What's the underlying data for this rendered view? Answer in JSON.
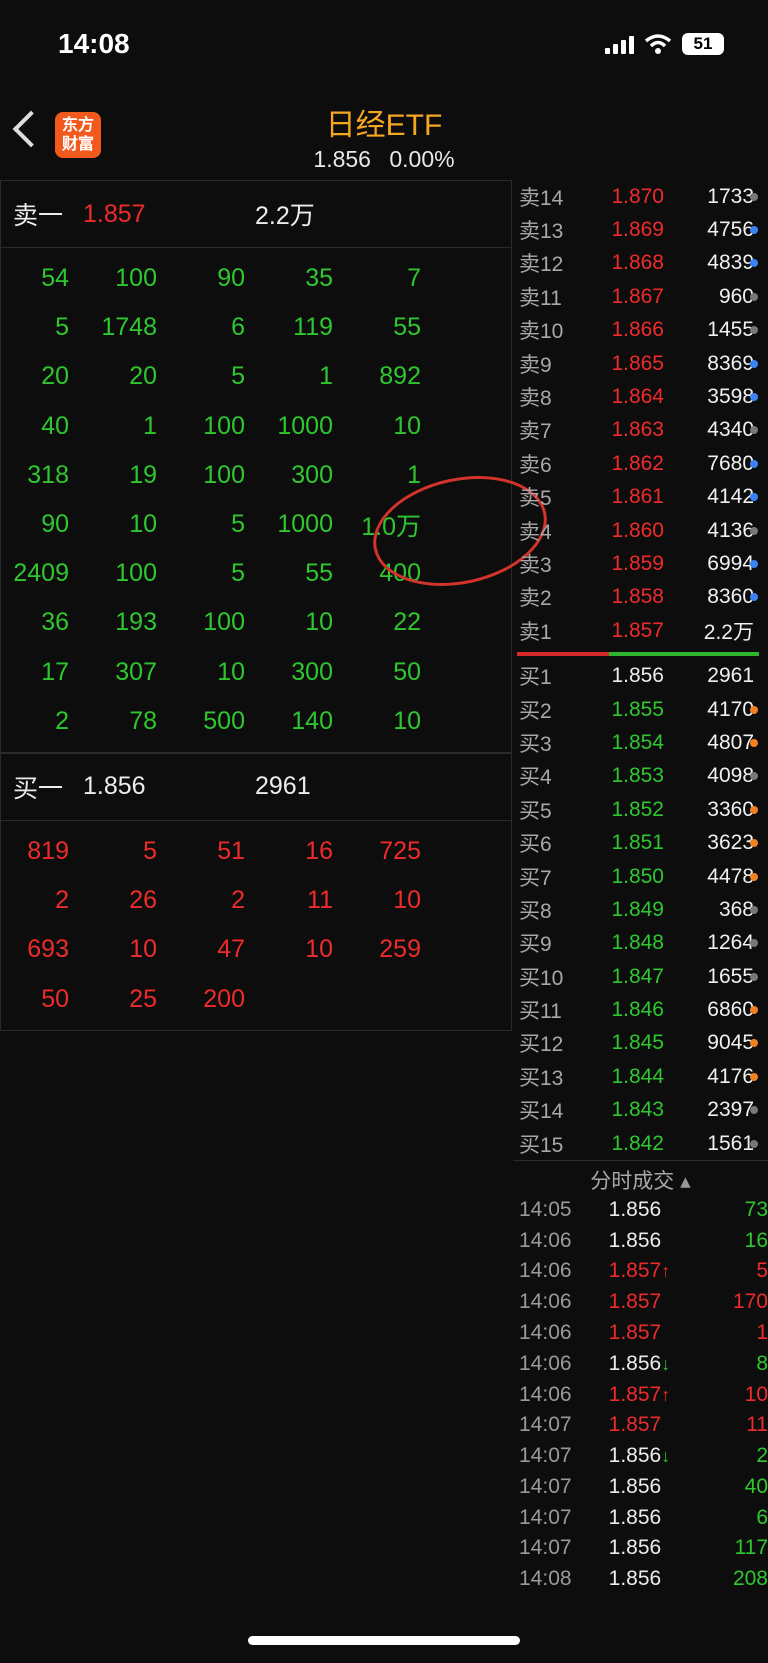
{
  "status": {
    "time": "14:08",
    "battery": "51"
  },
  "header": {
    "logo_line1": "东方",
    "logo_line2": "财富",
    "title": "日经ETF",
    "price": "1.856",
    "change": "0.00%"
  },
  "left": {
    "sell1": {
      "label": "卖一",
      "price": "1.857",
      "volume": "2.2万"
    },
    "sell_queue": [
      [
        "54",
        "100",
        "90",
        "35",
        "7"
      ],
      [
        "5",
        "1748",
        "6",
        "119",
        "55"
      ],
      [
        "20",
        "20",
        "5",
        "1",
        "892"
      ],
      [
        "40",
        "1",
        "100",
        "1000",
        "10"
      ],
      [
        "318",
        "19",
        "100",
        "300",
        "1"
      ],
      [
        "90",
        "10",
        "5",
        "1000",
        "1.0万"
      ],
      [
        "2409",
        "100",
        "5",
        "55",
        "400"
      ],
      [
        "36",
        "193",
        "100",
        "10",
        "22"
      ],
      [
        "17",
        "307",
        "10",
        "300",
        "50"
      ],
      [
        "2",
        "78",
        "500",
        "140",
        "10"
      ]
    ],
    "buy1": {
      "label": "买一",
      "price": "1.856",
      "volume": "2961"
    },
    "buy_queue": [
      [
        "819",
        "5",
        "51",
        "16",
        "725"
      ],
      [
        "2",
        "26",
        "2",
        "11",
        "10"
      ],
      [
        "693",
        "10",
        "47",
        "10",
        "259"
      ],
      [
        "50",
        "25",
        "200",
        "",
        ""
      ]
    ]
  },
  "asks": [
    {
      "label": "卖14",
      "price": "1.870",
      "volume": "1733",
      "dot": "#777777"
    },
    {
      "label": "卖13",
      "price": "1.869",
      "volume": "4756",
      "dot": "#3b82f6"
    },
    {
      "label": "卖12",
      "price": "1.868",
      "volume": "4839",
      "dot": "#3b82f6"
    },
    {
      "label": "卖11",
      "price": "1.867",
      "volume": "960",
      "dot": "#777777"
    },
    {
      "label": "卖10",
      "price": "1.866",
      "volume": "1455",
      "dot": "#777777"
    },
    {
      "label": "卖9",
      "price": "1.865",
      "volume": "8369",
      "dot": "#3b82f6"
    },
    {
      "label": "卖8",
      "price": "1.864",
      "volume": "3598",
      "dot": "#3b82f6"
    },
    {
      "label": "卖7",
      "price": "1.863",
      "volume": "4340",
      "dot": "#777777"
    },
    {
      "label": "卖6",
      "price": "1.862",
      "volume": "7680",
      "dot": "#3b82f6"
    },
    {
      "label": "卖5",
      "price": "1.861",
      "volume": "4142",
      "dot": "#3b82f6"
    },
    {
      "label": "卖4",
      "price": "1.860",
      "volume": "4136",
      "dot": "#777777"
    },
    {
      "label": "卖3",
      "price": "1.859",
      "volume": "6994",
      "dot": "#3b82f6"
    },
    {
      "label": "卖2",
      "price": "1.858",
      "volume": "8360",
      "dot": "#3b82f6"
    },
    {
      "label": "卖1",
      "price": "1.857",
      "volume": "2.2万",
      "dot": ""
    }
  ],
  "bids": [
    {
      "label": "买1",
      "price": "1.856",
      "volume": "2961",
      "dot": ""
    },
    {
      "label": "买2",
      "price": "1.855",
      "volume": "4170",
      "dot": "#f08020"
    },
    {
      "label": "买3",
      "price": "1.854",
      "volume": "4807",
      "dot": "#f08020"
    },
    {
      "label": "买4",
      "price": "1.853",
      "volume": "4098",
      "dot": "#777777"
    },
    {
      "label": "买5",
      "price": "1.852",
      "volume": "3360",
      "dot": "#f08020"
    },
    {
      "label": "买6",
      "price": "1.851",
      "volume": "3623",
      "dot": "#f08020"
    },
    {
      "label": "买7",
      "price": "1.850",
      "volume": "4478",
      "dot": "#f08020"
    },
    {
      "label": "买8",
      "price": "1.849",
      "volume": "368",
      "dot": "#777777"
    },
    {
      "label": "买9",
      "price": "1.848",
      "volume": "1264",
      "dot": "#777777"
    },
    {
      "label": "买10",
      "price": "1.847",
      "volume": "1655",
      "dot": "#777777"
    },
    {
      "label": "买11",
      "price": "1.846",
      "volume": "6860",
      "dot": "#f08020"
    },
    {
      "label": "买12",
      "price": "1.845",
      "volume": "9045",
      "dot": "#f08020"
    },
    {
      "label": "买13",
      "price": "1.844",
      "volume": "4176",
      "dot": "#f08020"
    },
    {
      "label": "买14",
      "price": "1.843",
      "volume": "2397",
      "dot": "#777777"
    },
    {
      "label": "买15",
      "price": "1.842",
      "volume": "1561",
      "dot": "#777777"
    }
  ],
  "trades_title": "分时成交",
  "trades": [
    {
      "time": "14:05",
      "price": "1.856",
      "arrow": "",
      "dir": "white",
      "volume": "73",
      "vcolor": "green"
    },
    {
      "time": "14:06",
      "price": "1.856",
      "arrow": "",
      "dir": "white",
      "volume": "16",
      "vcolor": "green"
    },
    {
      "time": "14:06",
      "price": "1.857",
      "arrow": "↑",
      "dir": "red",
      "volume": "5",
      "vcolor": "red"
    },
    {
      "time": "14:06",
      "price": "1.857",
      "arrow": "",
      "dir": "red",
      "volume": "170",
      "vcolor": "red"
    },
    {
      "time": "14:06",
      "price": "1.857",
      "arrow": "",
      "dir": "red",
      "volume": "1",
      "vcolor": "red"
    },
    {
      "time": "14:06",
      "price": "1.856",
      "arrow": "↓",
      "dir": "white",
      "volume": "8",
      "vcolor": "green"
    },
    {
      "time": "14:06",
      "price": "1.857",
      "arrow": "↑",
      "dir": "red",
      "volume": "10",
      "vcolor": "red"
    },
    {
      "time": "14:07",
      "price": "1.857",
      "arrow": "",
      "dir": "red",
      "volume": "11",
      "vcolor": "red"
    },
    {
      "time": "14:07",
      "price": "1.856",
      "arrow": "↓",
      "dir": "white",
      "volume": "2",
      "vcolor": "green"
    },
    {
      "time": "14:07",
      "price": "1.856",
      "arrow": "",
      "dir": "white",
      "volume": "40",
      "vcolor": "green"
    },
    {
      "time": "14:07",
      "price": "1.856",
      "arrow": "",
      "dir": "white",
      "volume": "6",
      "vcolor": "green"
    },
    {
      "time": "14:07",
      "price": "1.856",
      "arrow": "",
      "dir": "white",
      "volume": "117",
      "vcolor": "green"
    },
    {
      "time": "14:08",
      "price": "1.856",
      "arrow": "",
      "dir": "white",
      "volume": "208",
      "vcolor": "green"
    }
  ]
}
